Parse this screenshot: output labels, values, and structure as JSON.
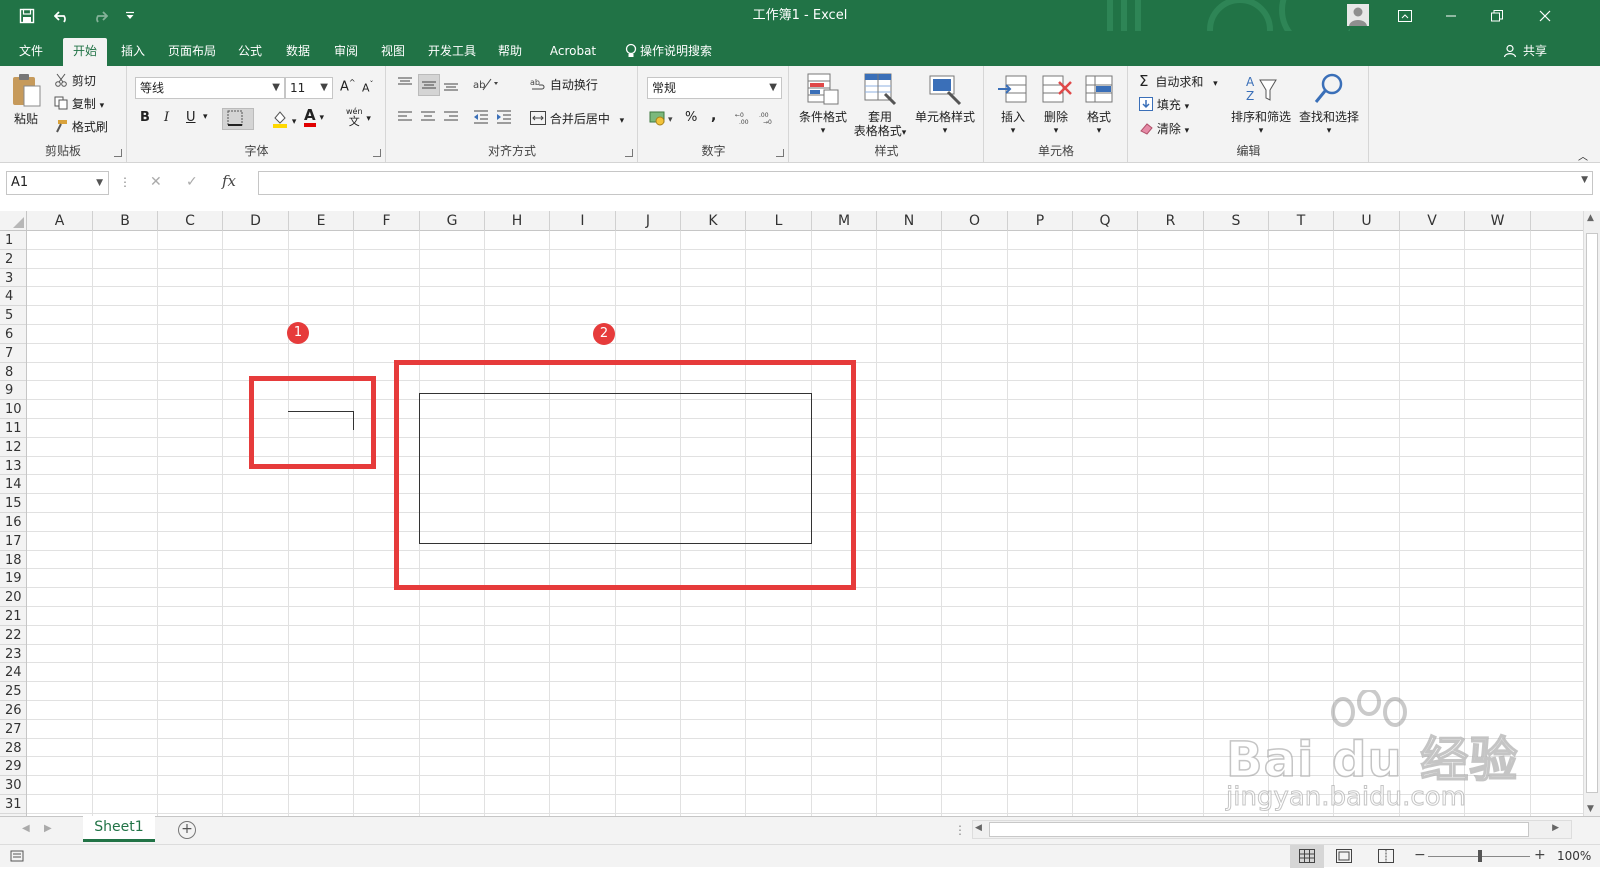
{
  "title_bar": {
    "title": "工作簿1 - Excel"
  },
  "ribbon_tabs": [
    "文件",
    "开始",
    "插入",
    "页面布局",
    "公式",
    "数据",
    "审阅",
    "视图",
    "开发工具",
    "帮助",
    "Acrobat",
    "操作说明搜索"
  ],
  "share_label": "共享",
  "clipboard": {
    "paste": "粘贴",
    "cut": "剪切",
    "copy": "复制",
    "format_painter": "格式刷",
    "group": "剪贴板"
  },
  "font": {
    "name": "等线",
    "size": "11",
    "bold": "B",
    "italic": "I",
    "underline": "U",
    "font_color_glyph": "A",
    "phonetic_glyph": "wén",
    "group": "字体"
  },
  "alignment": {
    "wrap": "自动换行",
    "merge": "合并后居中",
    "group": "对齐方式"
  },
  "number": {
    "format": "常规",
    "group": "数字"
  },
  "styles": {
    "conditional": "条件格式",
    "table_line1": "套用",
    "table_line2": "表格格式",
    "cell_styles": "单元格样式",
    "group": "样式"
  },
  "cells": {
    "insert": "插入",
    "delete": "删除",
    "format": "格式",
    "group": "单元格"
  },
  "editing": {
    "autosum": "自动求和",
    "fill": "填充",
    "clear": "清除",
    "sort": "排序和筛选",
    "find": "查找和选择",
    "group": "编辑"
  },
  "formula_bar": {
    "name_box": "A1",
    "fx": "fx"
  },
  "columns": [
    "A",
    "B",
    "C",
    "D",
    "E",
    "F",
    "G",
    "H",
    "I",
    "J",
    "K",
    "L",
    "M",
    "N",
    "O",
    "P",
    "Q",
    "R",
    "S",
    "T",
    "U",
    "V",
    "W"
  ],
  "rows": [
    "1",
    "2",
    "3",
    "4",
    "5",
    "6",
    "7",
    "8",
    "9",
    "10",
    "11",
    "12",
    "13",
    "14",
    "15",
    "16",
    "17",
    "18",
    "19",
    "20",
    "21",
    "22",
    "23",
    "24",
    "25",
    "26",
    "27",
    "28",
    "29",
    "30",
    "31"
  ],
  "annotations": [
    {
      "number": "1"
    },
    {
      "number": "2"
    }
  ],
  "sheet_tabs": [
    "Sheet1"
  ],
  "zoom": "100%",
  "watermark": {
    "brand": "Bai du 经验",
    "url": "jingyan.baidu.com"
  }
}
